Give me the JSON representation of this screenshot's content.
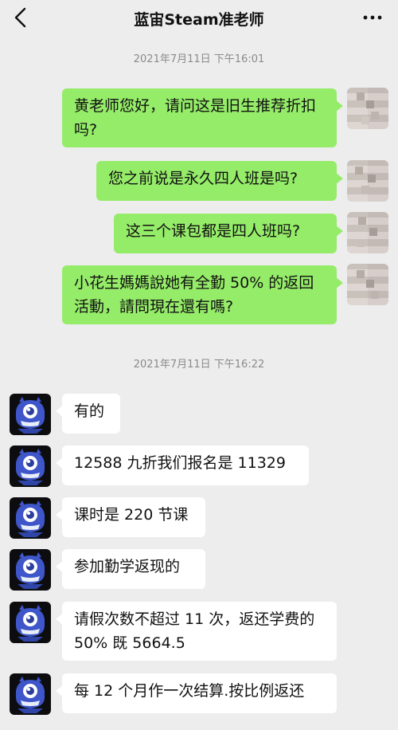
{
  "header": {
    "title": "蓝宙Steam准老师",
    "back_icon": "chevron-left-icon",
    "more_icon": "more-dots-icon"
  },
  "timestamps": [
    "2021年7月11日 下午16:01",
    "2021年7月11日 下午16:22"
  ],
  "outgoing": [
    "黄老师您好，请问这是旧生推荐折扣吗?",
    "您之前说是永久四人班是吗?",
    "这三个课包都是四人班吗?",
    "小花生媽媽說她有全勤 50% 的返回活動，請問現在還有嗎?"
  ],
  "incoming": [
    "有的",
    "12588 九折我们报名是 11329",
    "课时是 220 节课",
    "参加勤学返现的",
    "请假次数不超过 11 次，返还学费的 50% 既 5664.5",
    "每 12 个月作一次结算.按比例返还"
  ],
  "colors": {
    "background": "#ededed",
    "outgoing_bubble": "#95ec69",
    "incoming_bubble": "#ffffff",
    "timestamp_text": "#8a8a8a"
  }
}
